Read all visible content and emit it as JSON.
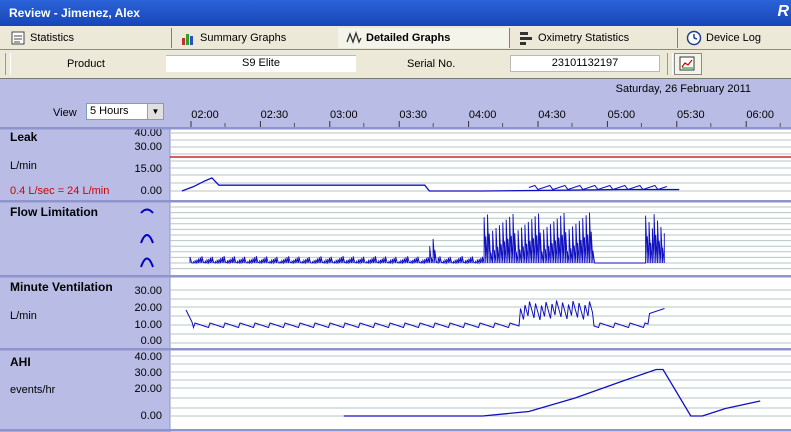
{
  "window": {
    "title": "Review - Jimenez, Alex",
    "logo": "R"
  },
  "tabs": [
    {
      "label": "Statistics",
      "icon": "statistics-icon"
    },
    {
      "label": "Summary Graphs",
      "icon": "bar-chart-icon"
    },
    {
      "label": "Detailed Graphs",
      "icon": "waveform-icon",
      "active": true
    },
    {
      "label": "Oximetry Statistics",
      "icon": "oximetry-icon"
    },
    {
      "label": "Device Log",
      "icon": "clock-icon"
    }
  ],
  "info": {
    "product_label": "Product",
    "product_value": "S9 Elite",
    "serial_label": "Serial No.",
    "serial_value": "23101132197"
  },
  "view": {
    "label": "View",
    "value": "5 Hours"
  },
  "date": "Saturday, 26 February 2011",
  "time_ticks": [
    "02:00",
    "02:30",
    "03:00",
    "03:30",
    "04:00",
    "04:30",
    "05:00",
    "05:30",
    "06:00"
  ],
  "panels": {
    "leak": {
      "title": "Leak",
      "unit": "L/min",
      "note": "0.4 L/sec = 24 L/min",
      "ticks": [
        "40.00",
        "30.00",
        "15.00",
        "0.00"
      ]
    },
    "flow": {
      "title": "Flow Limitation"
    },
    "mv": {
      "title": "Minute Ventilation",
      "unit": "L/min",
      "ticks": [
        "30.00",
        "20.00",
        "10.00",
        "0.00"
      ]
    },
    "ahi": {
      "title": "AHI",
      "unit": "events/hr",
      "ticks": [
        "40.00",
        "30.00",
        "20.00",
        "0.00"
      ]
    }
  },
  "colors": {
    "trace": "#1010c0",
    "threshold": "#c00000",
    "panel_bg": "#b9bde6"
  },
  "chart_data": {
    "type": "line",
    "x_range": [
      "01:50",
      "06:05"
    ],
    "series": [
      {
        "panel": "Leak",
        "x": [
          "01:50",
          "01:55",
          "02:00",
          "02:03",
          "02:06",
          "03:35",
          "03:37",
          "04:00",
          "05:00",
          "05:25"
        ],
        "y": [
          0,
          3,
          7,
          9,
          4,
          4,
          0,
          0,
          1,
          1
        ],
        "ylim": [
          0,
          40
        ],
        "threshold": 24
      },
      {
        "panel": "AHI",
        "x": [
          "03:00",
          "04:00",
          "04:20",
          "04:40",
          "05:00",
          "05:15",
          "05:18",
          "05:30",
          "05:35",
          "05:45",
          "06:00"
        ],
        "y": [
          0,
          0,
          3,
          12,
          23,
          31,
          31,
          0,
          0,
          5,
          10
        ],
        "ylim": [
          0,
          40
        ]
      }
    ]
  }
}
